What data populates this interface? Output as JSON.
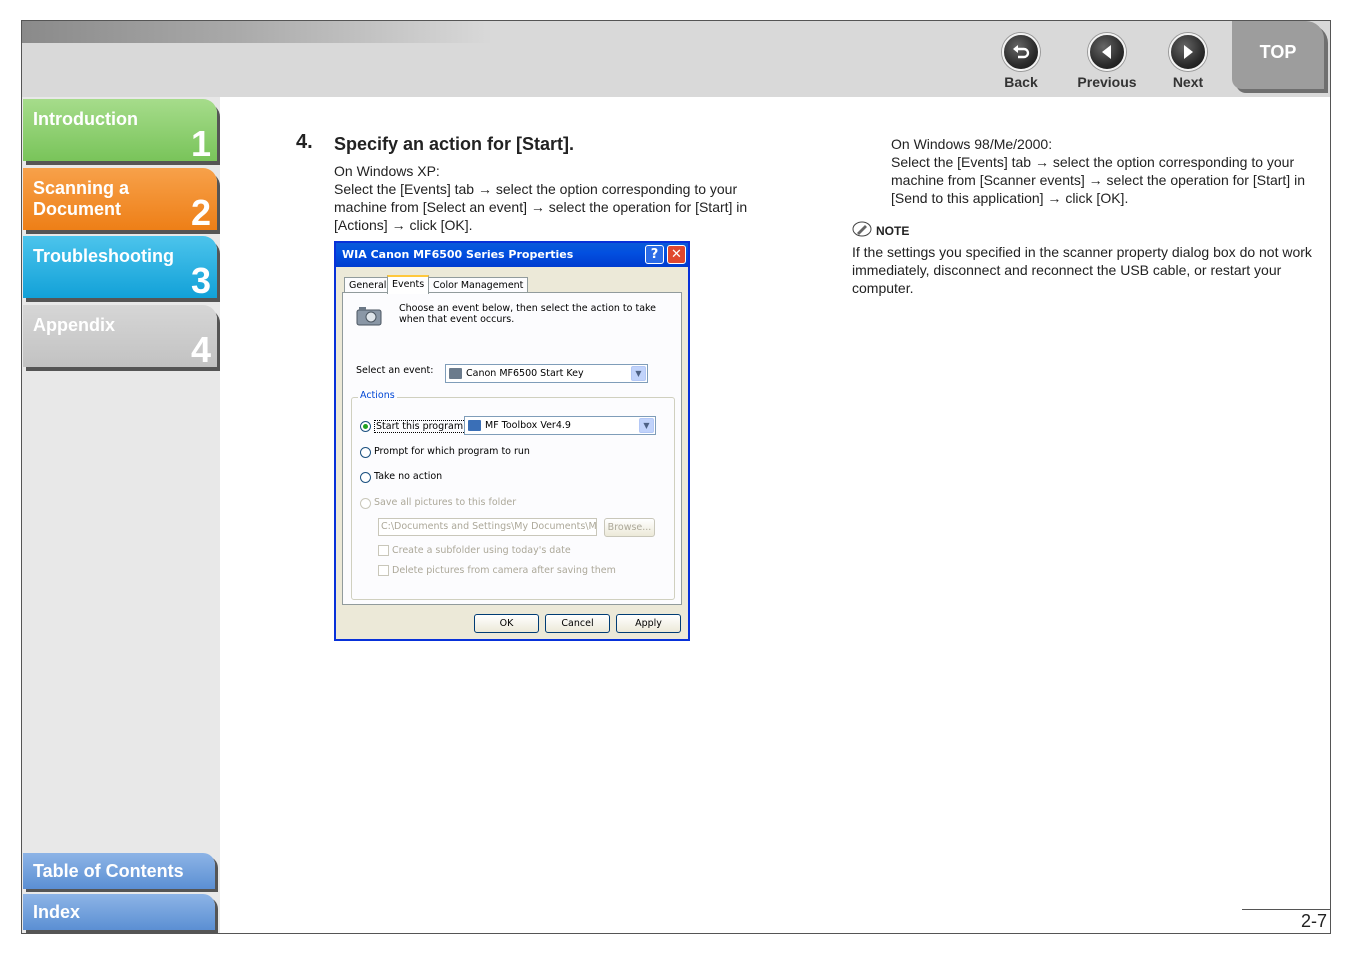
{
  "header": {
    "nav": {
      "back": "Back",
      "previous": "Previous",
      "next": "Next"
    },
    "top": "TOP"
  },
  "sidebar": {
    "chapters": [
      {
        "label": "Introduction",
        "number": "1"
      },
      {
        "label": "Scanning a Document",
        "number": "2"
      },
      {
        "label": "Troubleshooting",
        "number": "3"
      },
      {
        "label": "Appendix",
        "number": "4"
      }
    ],
    "toc": "Table of Contents",
    "index": "Index"
  },
  "step": {
    "number": "4.",
    "title": "Specify an action for [Start].",
    "xp_heading": "On Windows XP:",
    "xp_text": "Select the [Events] tab → select the option corresponding to your machine from [Select an event] → select the operation for [Start] in [Actions] → click [OK].",
    "w98_heading": "On Windows 98/Me/2000:",
    "w98_text": "Select the [Events] tab → select the option corresponding to your machine from [Scanner events] → select the operation for [Start] in [Send to this application] → click [OK]."
  },
  "note": {
    "heading": "NOTE",
    "text": "If the settings you specified in the scanner property dialog box do not work immediately, disconnect and reconnect the USB cable, or restart your computer."
  },
  "dialog": {
    "title": "WIA Canon MF6500 Series Properties",
    "help_btn": "?",
    "close_btn": "✕",
    "tabs": [
      "General",
      "Events",
      "Color Management"
    ],
    "intro": "Choose an event below, then select the action to take when that event occurs.",
    "select_event_label": "Select an event:",
    "select_event_value": "Canon MF6500 Start Key",
    "actions_label": "Actions",
    "start_program": "Start this program:",
    "program_value": "MF Toolbox Ver4.9",
    "prompt": "Prompt for which program to run",
    "no_action": "Take no action",
    "save_pictures": "Save all pictures to this folder",
    "folder_path": "C:\\Documents and Settings\\My Documents\\My Pic",
    "browse": "Browse...",
    "subfolder": "Create a subfolder using today's date",
    "delete": "Delete pictures from camera after saving them",
    "ok": "OK",
    "cancel": "Cancel",
    "apply": "Apply"
  },
  "page_number": "2-7"
}
